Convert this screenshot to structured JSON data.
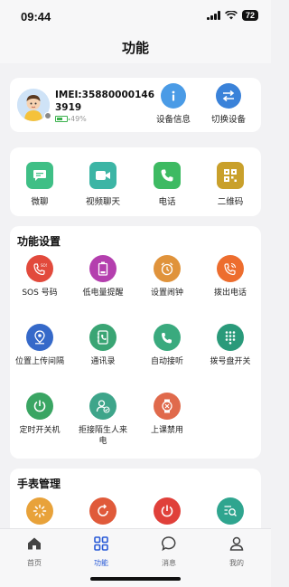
{
  "status_bar": {
    "time": "09:44",
    "battery": "72"
  },
  "nav": {
    "title": "功能"
  },
  "device": {
    "imei": "IMEI:358800001463919",
    "battery_percent": "49%",
    "info_label": "设备信息",
    "switch_label": "切换设备"
  },
  "quick_actions": [
    {
      "label": "微聊",
      "color": "#3fbf86"
    },
    {
      "label": "视频聊天",
      "color": "#3cb5a5"
    },
    {
      "label": "电话",
      "color": "#3dba62"
    },
    {
      "label": "二维码",
      "color": "#c9a02b"
    }
  ],
  "function_settings": {
    "title": "功能设置",
    "items": [
      {
        "label": "SOS 号码",
        "color": "#e24a3c",
        "icon": "sos-phone-icon"
      },
      {
        "label": "低电量提醒",
        "color": "#b43fae",
        "icon": "low-battery-icon"
      },
      {
        "label": "设置闹钟",
        "color": "#e0933b",
        "icon": "alarm-clock-icon"
      },
      {
        "label": "拨出电话",
        "color": "#ed6d2e",
        "icon": "outgoing-call-icon"
      },
      {
        "label": "位置上传间隔",
        "color": "#3569c9",
        "icon": "location-pin-icon"
      },
      {
        "label": "通讯录",
        "color": "#3aa574",
        "icon": "contacts-book-icon"
      },
      {
        "label": "自动接听",
        "color": "#3aaa7e",
        "icon": "auto-answer-icon"
      },
      {
        "label": "拨号盘开关",
        "color": "#2a9a7a",
        "icon": "dialpad-icon"
      },
      {
        "label": "定时开关机",
        "color": "#3aa563",
        "icon": "power-timer-icon"
      },
      {
        "label": "拒接陌生人来电",
        "color": "#3ea58a",
        "icon": "reject-stranger-icon"
      },
      {
        "label": "上课禁用",
        "color": "#e06a4c",
        "icon": "class-disable-icon"
      }
    ]
  },
  "watch_management": {
    "title": "手表管理",
    "items": [
      {
        "color": "#e8a23a",
        "icon": "loading-icon"
      },
      {
        "color": "#e05a3a",
        "icon": "restart-icon"
      },
      {
        "color": "#e0403a",
        "icon": "power-off-icon"
      },
      {
        "color": "#2fa58f",
        "icon": "search-list-icon"
      }
    ]
  },
  "tabs": [
    {
      "label": "首页",
      "icon": "home-icon",
      "active": false
    },
    {
      "label": "功能",
      "icon": "grid-icon",
      "active": true
    },
    {
      "label": "消息",
      "icon": "chat-bubble-icon",
      "active": false
    },
    {
      "label": "我的",
      "icon": "profile-icon",
      "active": false
    }
  ],
  "colors": {
    "accent": "#2a5bd7",
    "info_blue": "#4a9be6",
    "switch_blue": "#3a82d9"
  }
}
